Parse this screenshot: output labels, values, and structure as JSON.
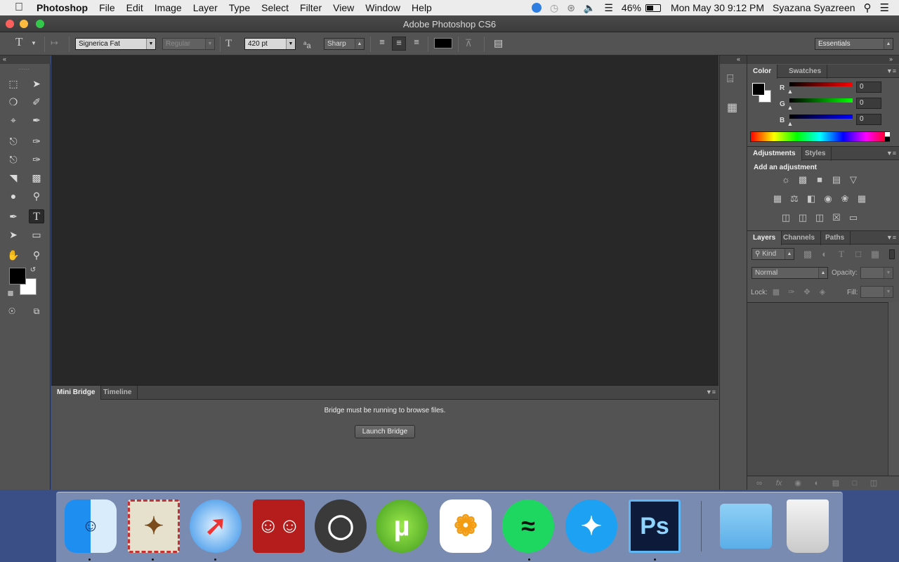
{
  "menubar": {
    "apple_icon": "apple-icon",
    "app_name": "Photoshop",
    "menus": [
      "File",
      "Edit",
      "Image",
      "Layer",
      "Type",
      "Select",
      "Filter",
      "View",
      "Window",
      "Help"
    ],
    "battery": "46%",
    "datetime": "Mon May 30  9:12 PM",
    "user": "Syazana Syazreen"
  },
  "window": {
    "title": "Adobe Photoshop CS6"
  },
  "options": {
    "font_family": "Signerica Fat",
    "font_style": "Regular",
    "font_size": "420 pt",
    "antialias_label": "a",
    "antialias": "Sharp",
    "workspace": "Essentials",
    "text_color": "#000000"
  },
  "tools": {
    "foreground": "#000000",
    "background": "#ffffff"
  },
  "minibridge": {
    "tab_active": "Mini Bridge",
    "tab_other": "Timeline",
    "message": "Bridge must be running to browse files.",
    "launch_button": "Launch Bridge"
  },
  "color_panel": {
    "tab_active": "Color",
    "tab_other": "Swatches",
    "r_label": "R",
    "g_label": "G",
    "b_label": "B",
    "r_value": "0",
    "g_value": "0",
    "b_value": "0"
  },
  "adjustments_panel": {
    "tab_active": "Adjustments",
    "tab_other": "Styles",
    "heading": "Add an adjustment"
  },
  "layers_panel": {
    "tab_active": "Layers",
    "tab_channels": "Channels",
    "tab_paths": "Paths",
    "kind": "Kind",
    "blend_mode": "Normal",
    "opacity_label": "Opacity:",
    "lock_label": "Lock:",
    "fill_label": "Fill:"
  },
  "dock": {
    "items": [
      "Finder",
      "Mail",
      "Safari",
      "Photo Booth",
      "Ubuntu",
      "uTorrent",
      "Photos",
      "Spotify",
      "Twitter",
      "Photoshop",
      "Folder",
      "Trash"
    ],
    "ps_label": "Ps"
  }
}
